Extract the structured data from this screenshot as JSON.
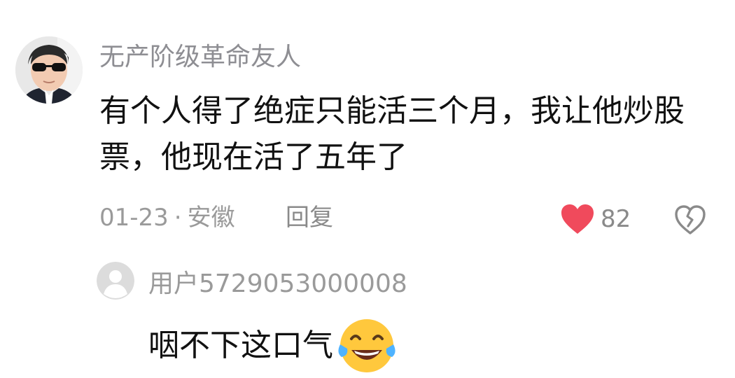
{
  "main_comment": {
    "username": "无产阶级革命友人",
    "text": "有个人得了绝症只能活三个月，我让他炒股票，他现在活了五年了",
    "date": "01-23",
    "separator": "·",
    "location": "安徽",
    "reply_label": "回复",
    "like_count": "82",
    "avatar_icon": "user-avatar-sunglasses",
    "like_icon": "heart-icon",
    "dislike_icon": "broken-heart-icon",
    "colors": {
      "like": "#f04a5c",
      "meta": "#9a9a9a",
      "username": "#8e8e93",
      "text": "#111111"
    }
  },
  "reply": {
    "username": "用户5729053000008",
    "text": "咽不下这口气",
    "avatar_icon": "default-user-avatar",
    "emoji_icon": "tears-of-joy-emoji"
  }
}
